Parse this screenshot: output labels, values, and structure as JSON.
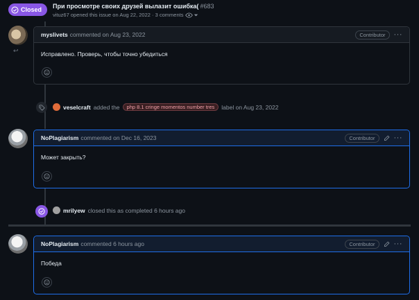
{
  "header": {
    "status": "Closed",
    "title": "При просмотре своих друзей вылазит ошибка(",
    "number": "#683",
    "meta": "vituz67 opened this issue on Aug 22, 2022 · 3 comments"
  },
  "comments": [
    {
      "author": "myslivets",
      "action": "commented on Aug 23, 2022",
      "role": "Contributor",
      "body": "Исправлено. Проверь, чтобы точно убедиться"
    },
    {
      "author": "NoPlagiarism",
      "action": "commented on Dec 16, 2023",
      "role": "Contributor",
      "body": "Может закрыть?"
    },
    {
      "author": "NoPlagiarism",
      "action": "commented 6 hours ago",
      "role": "Contributor",
      "body": "Победа"
    }
  ],
  "events": {
    "label_event": {
      "actor": "veselcraft",
      "pre": "added the",
      "label": "php 8.1 cringe momentos number tres",
      "post": "label on Aug 23, 2022"
    },
    "close_event": {
      "actor": "mrilyew",
      "text": "closed this as completed 6 hours ago"
    }
  },
  "colors": {
    "closed_purple": "#8957e5",
    "highlight_blue": "#1f6feb",
    "background": "#0d1117"
  }
}
